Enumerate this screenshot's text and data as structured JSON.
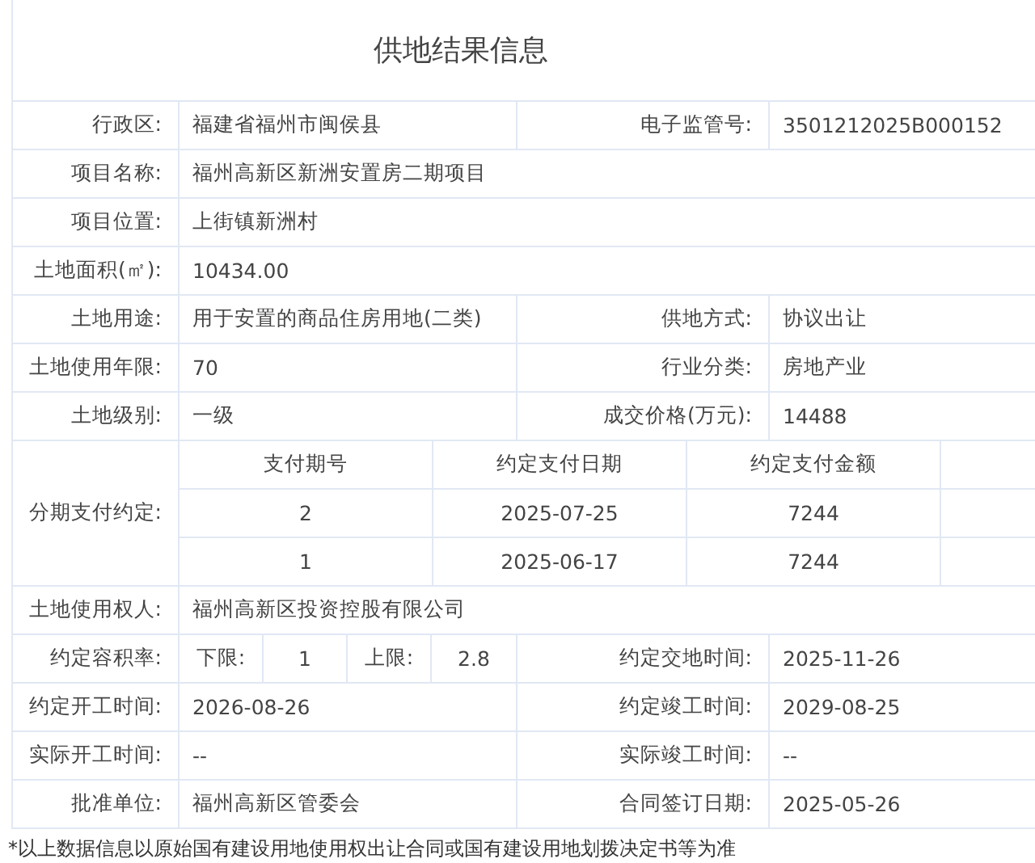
{
  "title": "供地结果信息",
  "rows": [
    {
      "kind": "pair",
      "label": "行政区:",
      "value": "福建省福州市闽侯县",
      "label2": "电子监管号:",
      "value2": "3501212025B000152"
    },
    {
      "kind": "single",
      "label": "项目名称:",
      "value": "福州高新区新洲安置房二期项目"
    },
    {
      "kind": "single",
      "label": "项目位置:",
      "value": "上街镇新洲村"
    },
    {
      "kind": "single",
      "label": "土地面积(㎡):",
      "value": "10434.00"
    },
    {
      "kind": "pair",
      "label": "土地用途:",
      "value": "用于安置的商品住房用地(二类)",
      "label2": "供地方式:",
      "value2": "协议出让"
    },
    {
      "kind": "pair",
      "label": "土地使用年限:",
      "value": "70",
      "label2": "行业分类:",
      "value2": "房地产业"
    },
    {
      "kind": "pair",
      "label": "土地级别:",
      "value": "一级",
      "label2": "成交价格(万元):",
      "value2": "14488"
    },
    {
      "kind": "payments",
      "label": "分期支付约定:",
      "columns": [
        "支付期号",
        "约定支付日期",
        "约定支付金额"
      ],
      "rows": [
        [
          "2",
          "2025-07-25",
          "7244"
        ],
        [
          "1",
          "2025-06-17",
          "7244"
        ]
      ]
    },
    {
      "kind": "single",
      "label": "土地使用权人:",
      "value": "福州高新区投资控股有限公司"
    },
    {
      "kind": "ratio",
      "label": "约定容积率:",
      "lower_label": "下限:",
      "lower": "1",
      "upper_label": "上限:",
      "upper": "2.8",
      "label2": "约定交地时间:",
      "value2": "2025-11-26"
    },
    {
      "kind": "pair",
      "label": "约定开工时间:",
      "value": "2026-08-26",
      "label2": "约定竣工时间:",
      "value2": "2029-08-25"
    },
    {
      "kind": "pair",
      "label": "实际开工时间:",
      "value": "--",
      "label2": "实际竣工时间:",
      "value2": "--"
    },
    {
      "kind": "pair",
      "label": "批准单位:",
      "value": "福州高新区管委会",
      "label2": "合同签订日期:",
      "value2": "2025-05-26"
    }
  ],
  "footnote": "*以上数据信息以原始国有建设用地使用权出让合同或国有建设用地划拨决定书等为准"
}
